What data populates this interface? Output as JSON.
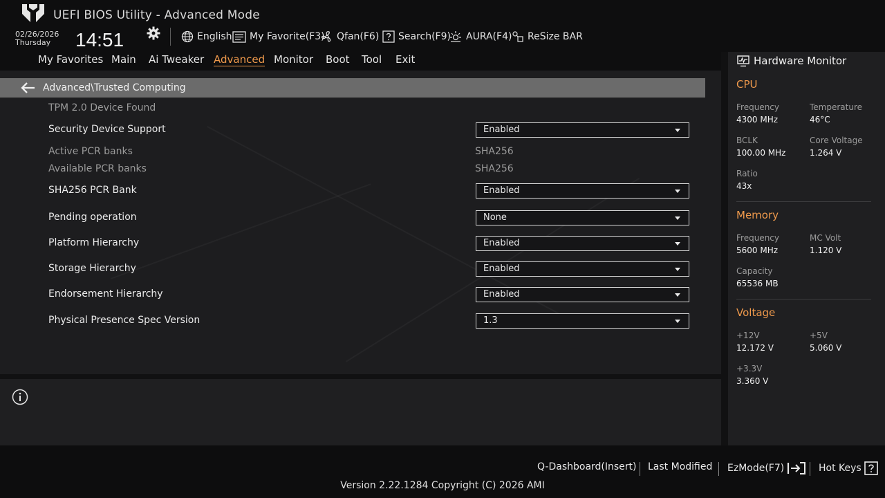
{
  "header": {
    "title": "UEFI BIOS Utility - Advanced Mode",
    "date": "02/26/2026",
    "weekday": "Thursday",
    "time": "14:51"
  },
  "toolbar": [
    {
      "label": "English",
      "icon": "globe-icon"
    },
    {
      "label": "My Favorite(F3)",
      "icon": "favorite-icon"
    },
    {
      "label": "Qfan(F6)",
      "icon": "fan-icon"
    },
    {
      "label": "Search(F9)",
      "icon": "search-icon"
    },
    {
      "label": "AURA(F4)",
      "icon": "aura-icon"
    },
    {
      "label": "ReSize BAR",
      "icon": "resize-bar-icon"
    }
  ],
  "tabs": [
    {
      "label": "My Favorites"
    },
    {
      "label": "Main"
    },
    {
      "label": "Ai Tweaker"
    },
    {
      "label": "Advanced",
      "active": true
    },
    {
      "label": "Monitor"
    },
    {
      "label": "Boot"
    },
    {
      "label": "Tool"
    },
    {
      "label": "Exit"
    }
  ],
  "breadcrumb": "Advanced\\Trusted Computing",
  "settings": {
    "tpm_found": "TPM 2.0 Device Found",
    "security_device_support": {
      "label": "Security Device Support",
      "value": "Enabled"
    },
    "active_pcr_banks": {
      "label": "Active PCR banks",
      "value": "SHA256"
    },
    "available_pcr_banks": {
      "label": "Available PCR banks",
      "value": "SHA256"
    },
    "sha256_pcr_bank": {
      "label": "SHA256 PCR Bank",
      "value": "Enabled"
    },
    "pending_operation": {
      "label": "Pending operation",
      "value": "None"
    },
    "platform_hierarchy": {
      "label": "Platform Hierarchy",
      "value": "Enabled"
    },
    "storage_hierarchy": {
      "label": "Storage Hierarchy",
      "value": "Enabled"
    },
    "endorsement_hierarchy": {
      "label": "Endorsement Hierarchy",
      "value": "Enabled"
    },
    "physical_presence": {
      "label": "Physical Presence Spec Version",
      "value": "1.3"
    }
  },
  "hardware_monitor": {
    "title": "Hardware Monitor",
    "cpu": {
      "title": "CPU",
      "frequency_label": "Frequency",
      "frequency": "4300 MHz",
      "temperature_label": "Temperature",
      "temperature": "46°C",
      "bclk_label": "BCLK",
      "bclk": "100.00 MHz",
      "core_voltage_label": "Core Voltage",
      "core_voltage": "1.264 V",
      "ratio_label": "Ratio",
      "ratio": "43x"
    },
    "memory": {
      "title": "Memory",
      "frequency_label": "Frequency",
      "frequency": "5600 MHz",
      "mc_volt_label": "MC Volt",
      "mc_volt": "1.120 V",
      "capacity_label": "Capacity",
      "capacity": "65536 MB"
    },
    "voltage": {
      "title": "Voltage",
      "v12_label": "+12V",
      "v12": "12.172 V",
      "v5_label": "+5V",
      "v5": "5.060 V",
      "v33_label": "+3.3V",
      "v33": "3.360 V"
    }
  },
  "footer": {
    "q_dashboard": "Q-Dashboard(Insert)",
    "last_modified": "Last Modified",
    "ezmode": "EzMode(F7)",
    "hot_keys": "Hot Keys",
    "version": "Version 2.22.1284 Copyright (C) 2026 AMI"
  },
  "colors": {
    "accent": "#f09a4c",
    "background": "#1b1b1d"
  }
}
